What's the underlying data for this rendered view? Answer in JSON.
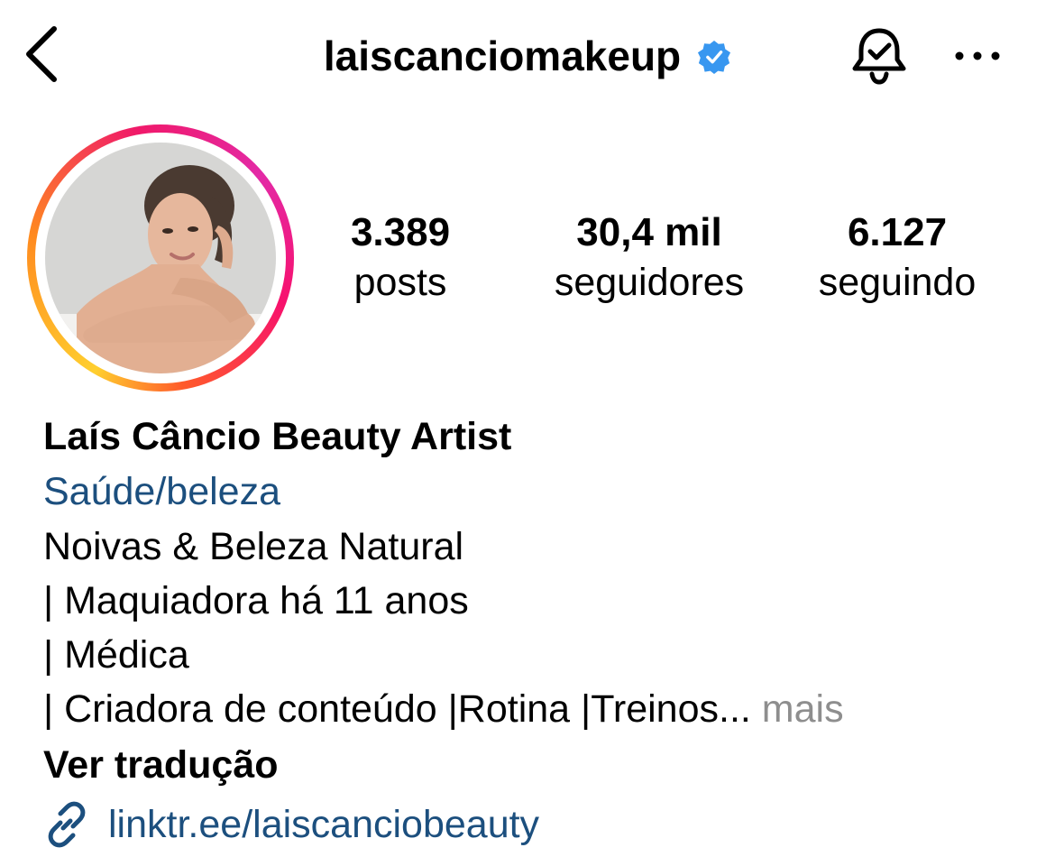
{
  "header": {
    "username": "laiscanciomakeup",
    "verified": true
  },
  "profile": {
    "stats": {
      "posts": {
        "value": "3.389",
        "label": "posts"
      },
      "followers": {
        "value": "30,4 mil",
        "label": "seguidores"
      },
      "following": {
        "value": "6.127",
        "label": "seguindo"
      }
    },
    "display_name": "Laís Câncio Beauty Artist",
    "category": "Saúde/beleza",
    "bio": {
      "line1": "Noivas & Beleza Natural",
      "line2": "| Maquiadora há 11 anos",
      "line3": "| Médica",
      "line4": "| Criadora de conteúdo |Rotina |Treinos...",
      "more": " mais"
    },
    "translate": "Ver tradução",
    "link": "linktr.ee/laiscanciobeauty"
  },
  "icons": {
    "back": "chevron-left-icon",
    "verified": "verified-badge-icon",
    "notifications": "bell-check-icon",
    "more": "more-horizontal-icon",
    "link": "link-icon"
  },
  "colors": {
    "link_blue": "#1c4f7e",
    "verified_blue": "#3897f0",
    "muted": "#8e8e8e",
    "story_ring": [
      "#ffcf2f",
      "#ff8a1f",
      "#f0196a",
      "#e32aa6"
    ]
  }
}
